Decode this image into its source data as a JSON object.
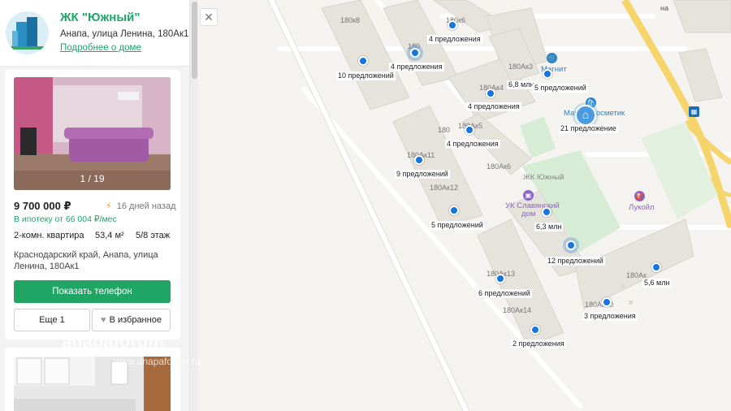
{
  "complex": {
    "title": "ЖК \"Южный\"",
    "address": "Анапа, улица Ленина, 180Ак1",
    "more_link": "Подробнее о доме"
  },
  "listing": {
    "photo_counter": "1 / 19",
    "price": "9 700 000 ₽",
    "posted": "16 дней назад",
    "mortgage": "В ипотеку от 66 004 ₽/мес",
    "rooms": "2-комн. квартира",
    "area": "53,4 м²",
    "floor": "5/8 этаж",
    "location": "Краснодарский край, Анапа, улица Ленина, 180Ак1",
    "phone_button": "Показать телефон",
    "more_button": "Еще 1",
    "favorite_button": "В избранное"
  },
  "watermark": {
    "main": "anapaforum",
    "sub": "www.anapaforum.ru"
  },
  "map": {
    "close_label": "✕",
    "offer_labels": [
      "4 предложения",
      "4 предложения",
      "10 предложений",
      "5 предложений",
      "4 предложения",
      "4 предложения",
      "21 предложение",
      "9 предложений",
      "5 предложений",
      "12 предложений",
      "6 предложений",
      "3 предложения",
      "2 предложения"
    ],
    "price_labels": [
      "6,8 млн",
      "6,3 млн",
      "5,6 млн"
    ],
    "building_labels": [
      "180к8",
      "180к6",
      "180Ак3",
      "180Ак4",
      "180Ак5",
      "180Ак11",
      "180Ак6",
      "180Ак12",
      "180Ак13",
      "180Ак14",
      "180Ак10",
      "180Ак"
    ],
    "building_labels_partial": [
      "180",
      "180"
    ],
    "poi_labels": {
      "magnit": "Магнит",
      "magnit_kosmetik": "Магнит Косметик",
      "complex_name": "ЖК Южный",
      "uk_line1": "УК Славянский",
      "uk_line2": "дом",
      "lukoil": "Лукойл",
      "street": "на"
    }
  },
  "colors": {
    "accent": "#1ea56a",
    "phone_button": "#21a565",
    "marker": "#1576e0",
    "poi": "#2a86c8",
    "park": "#d7ecd5"
  }
}
